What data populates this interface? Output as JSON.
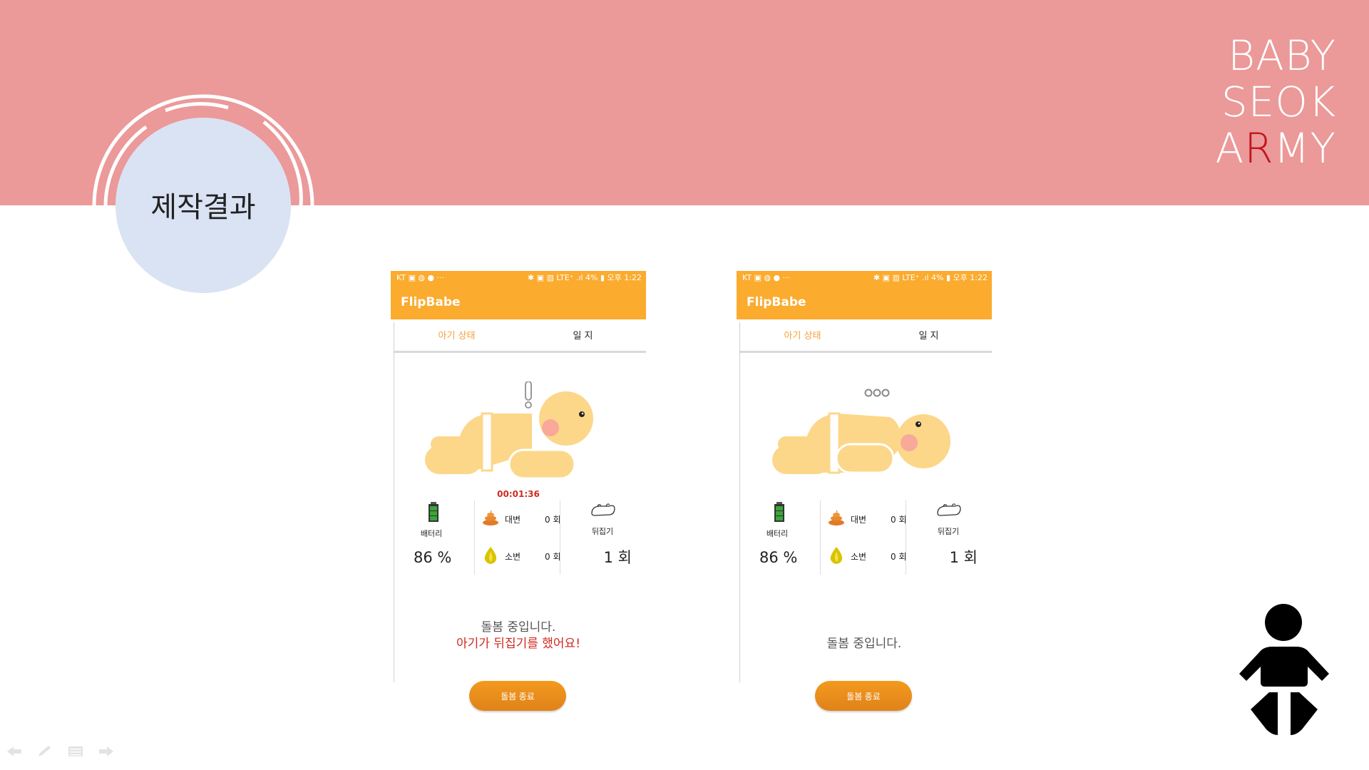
{
  "slide": {
    "brand_line1": "BABY",
    "brand_line2": "SEOK",
    "brand_line3_a": "A",
    "brand_line3_b": "R",
    "brand_line3_c": "MY",
    "title": "제작결과",
    "colors": {
      "band": "#eb9999",
      "circle": "#dae3f3",
      "app_orange": "#fbab2e",
      "alert_red": "#d02a1f"
    }
  },
  "phones": [
    {
      "status_left": "KT ▣ ◍ ● ···",
      "status_right": "✱ ▣ ▥ LTE⁺ .ıl 4% ▮ 오후 1:22",
      "app_title": "FlipBabe",
      "tab_status": "아기 상태",
      "tab_log": "일 지",
      "indicator": "!",
      "baby_pose": "flipped-prone",
      "timer": "00:01:36",
      "battery_label": "배터리",
      "battery_value": "86  %",
      "stool_label": "대변",
      "stool_count": "0 회",
      "urine_label": "소변",
      "urine_count": "0 회",
      "flip_label": "뒤집기",
      "flip_value": "1 회",
      "message_line1": "돌봄 중입니다.",
      "message_line2": "아기가 뒤집기를 했어요!",
      "end_button": "돌봄 종료"
    },
    {
      "status_left": "KT ▣ ◍ ● ···",
      "status_right": "✱ ▣ ▥ LTE⁺ .ıl 4% ▮ 오후 1:22",
      "app_title": "FlipBabe",
      "tab_status": "아기 상태",
      "tab_log": "일 지",
      "indicator": "ooo",
      "baby_pose": "lying",
      "battery_label": "배터리",
      "battery_value": "86  %",
      "stool_label": "대변",
      "stool_count": "0 회",
      "urine_label": "소변",
      "urine_count": "0 회",
      "flip_label": "뒤집기",
      "flip_value": "1 회",
      "message_line1": "돌봄 중입니다.",
      "end_button": "돌봄 종료"
    }
  ],
  "icons": [
    "battery-icon",
    "poop-icon",
    "drop-icon",
    "flip-icon",
    "baby-changing-icon",
    "arrow-left-icon",
    "pen-icon",
    "menu-icon",
    "arrow-right-icon"
  ]
}
